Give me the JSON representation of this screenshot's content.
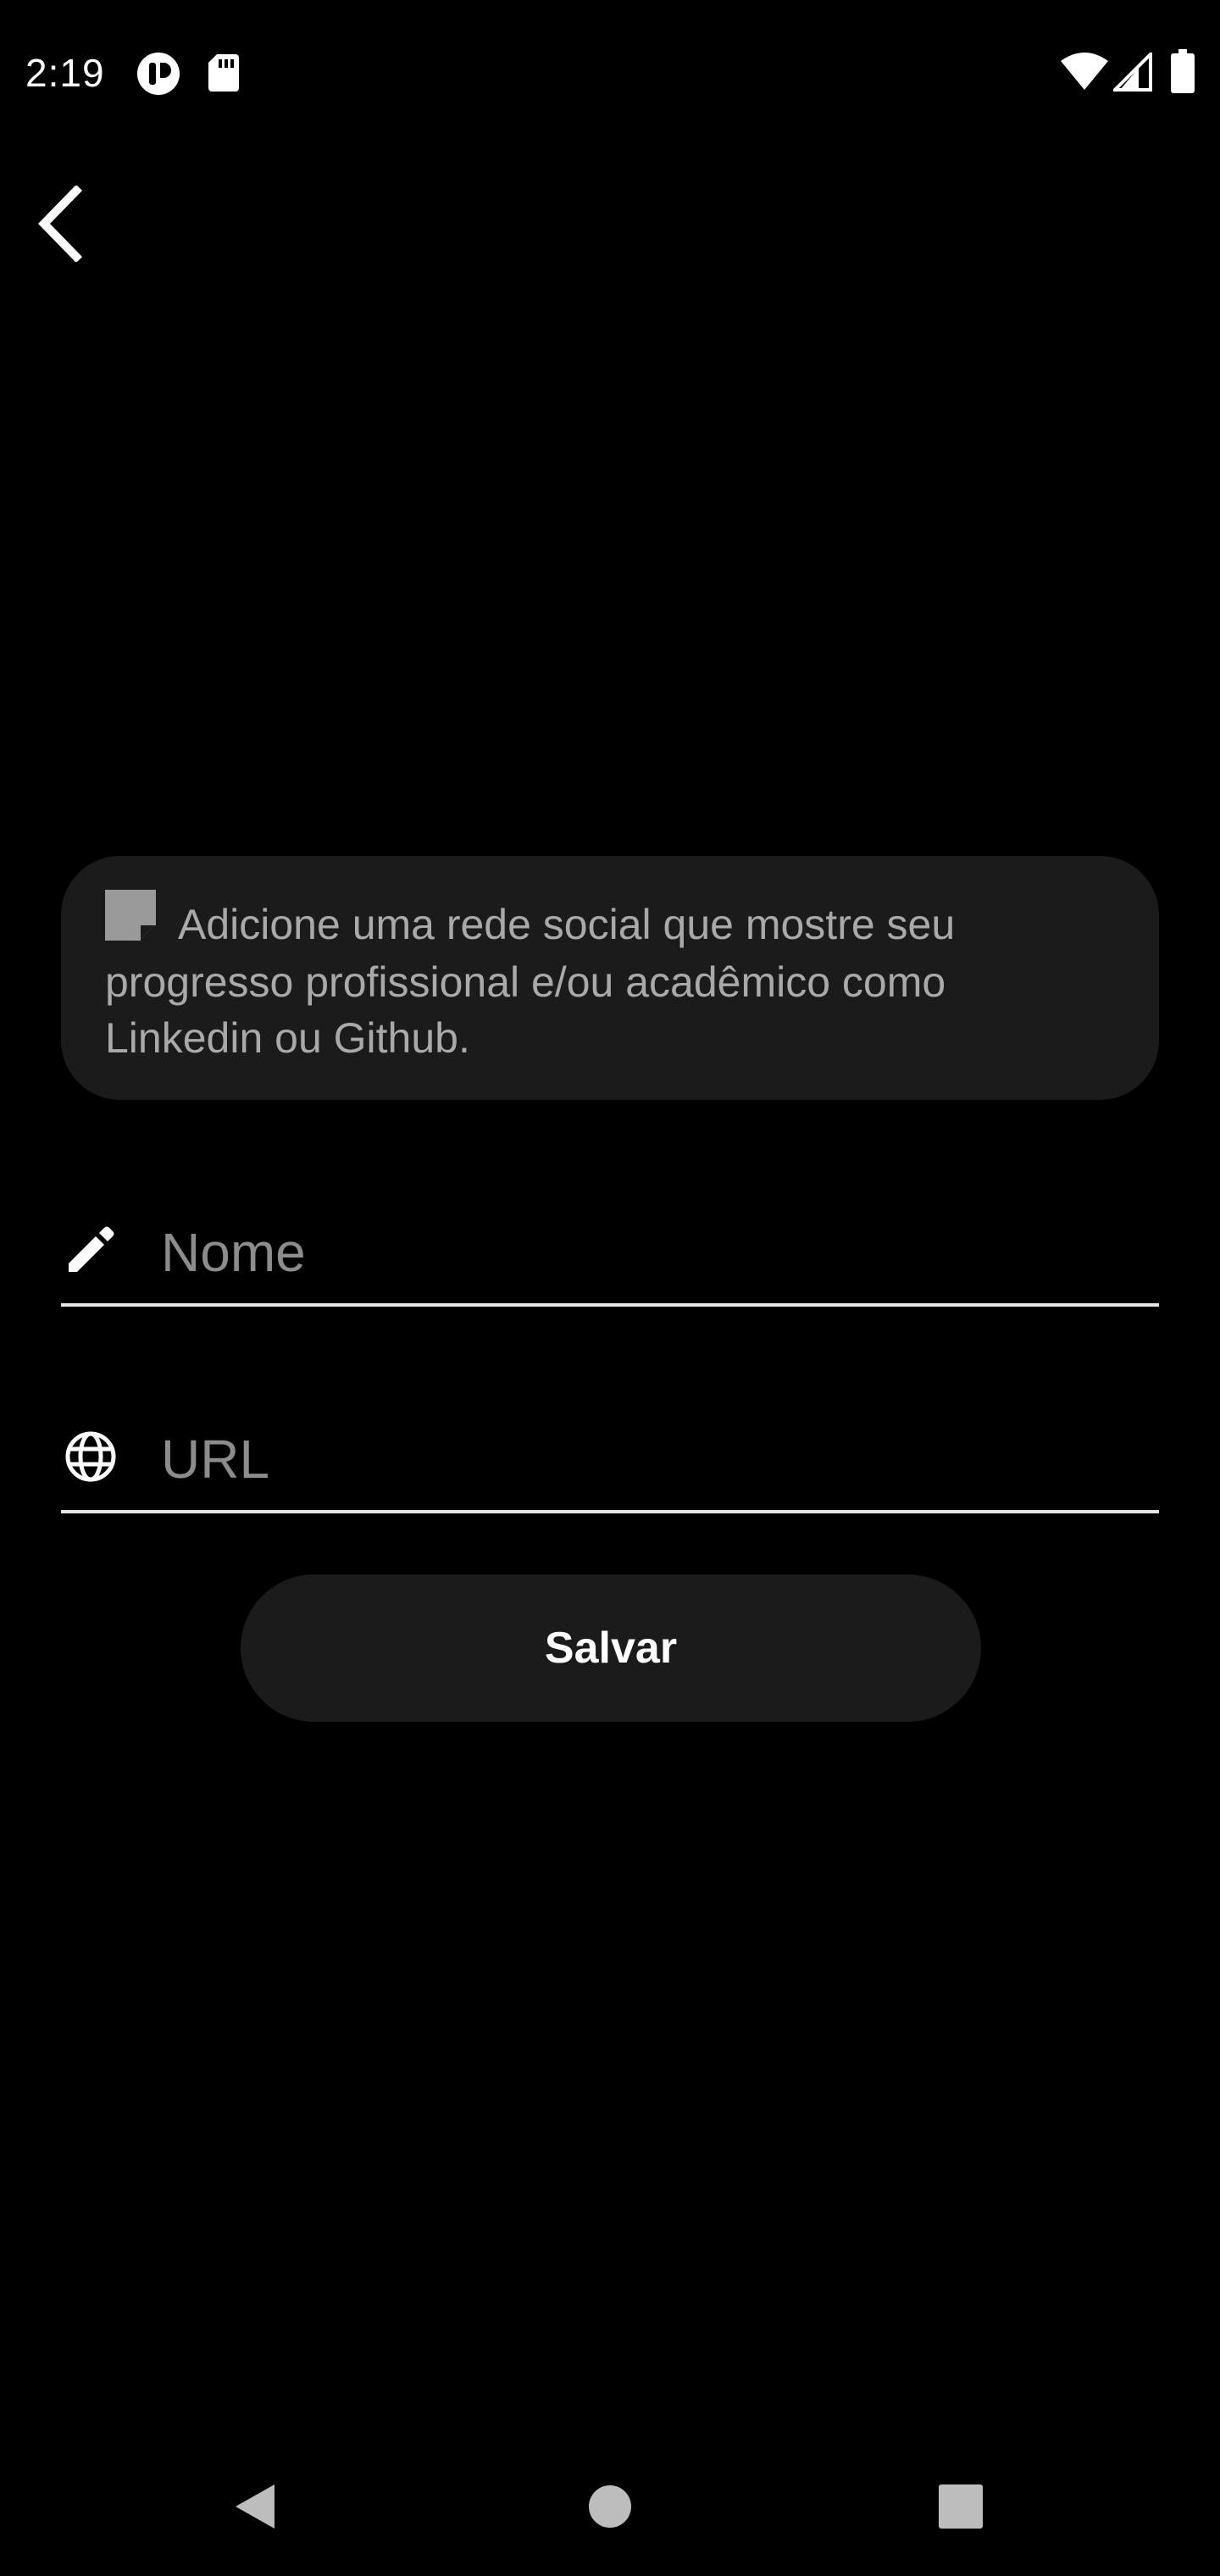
{
  "status_bar": {
    "time": "2:19",
    "icons": [
      "notification-app-icon",
      "sd-card-icon",
      "wifi-icon",
      "cell-signal-icon",
      "battery-icon"
    ]
  },
  "header": {
    "back_icon": "chevron-left-icon"
  },
  "info_card": {
    "icon": "note-icon",
    "text": "Adicione uma rede social que mostre seu progresso profissional e/ou acadêmico como Linkedin ou Github."
  },
  "form": {
    "name_field": {
      "icon": "pencil-icon",
      "placeholder": "Nome",
      "value": ""
    },
    "url_field": {
      "icon": "globe-icon",
      "placeholder": "URL",
      "value": ""
    },
    "save_label": "Salvar"
  },
  "nav_bar": {
    "items": [
      "back-triangle-icon",
      "home-circle-icon",
      "recents-square-icon"
    ]
  },
  "colors": {
    "background": "#000000",
    "card": "#1b1b1b",
    "text_muted": "#a9a9a9",
    "placeholder": "#8c8c8c",
    "underline": "#e6e6e6",
    "nav_icon": "#bdbdbd"
  }
}
